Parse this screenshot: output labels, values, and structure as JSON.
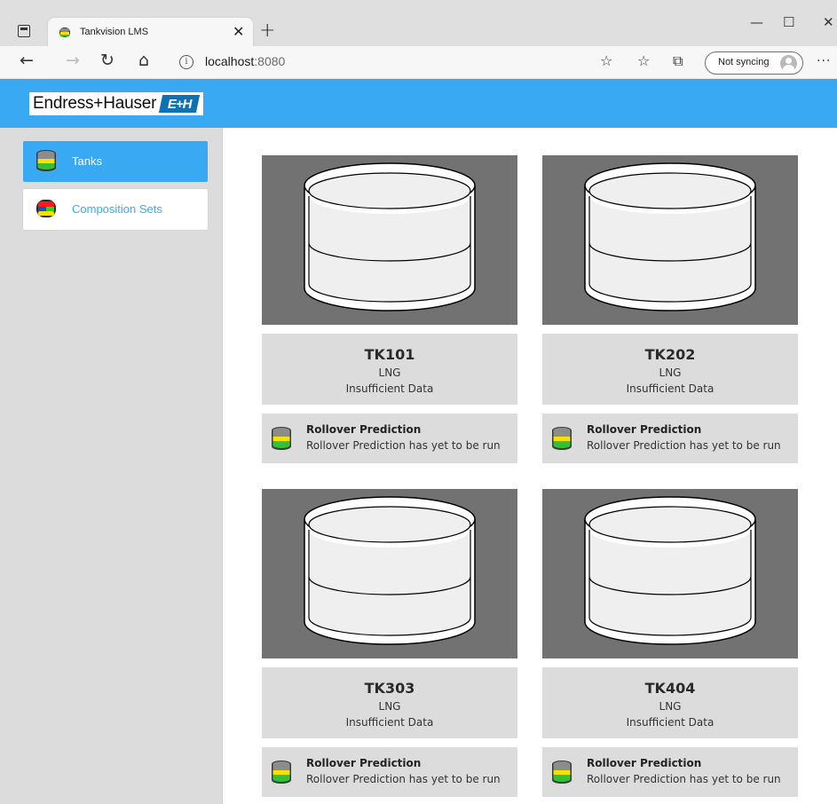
{
  "browser": {
    "tab_title": "Tankvision LMS",
    "url_host": "localhost",
    "url_port": ":8080",
    "sync_label": "Not syncing"
  },
  "app": {
    "brand": "Endress+Hauser",
    "brand_mark": "E+H",
    "accent_color": "#3aa9f4"
  },
  "sidebar": {
    "items": [
      {
        "label": "Tanks",
        "icon": "tank-icon",
        "active": true
      },
      {
        "label": "Composition Sets",
        "icon": "composition-sets-icon",
        "active": false
      }
    ]
  },
  "tanks": [
    {
      "name": "TK101",
      "product": "LNG",
      "status": "Insufficient Data",
      "rollover_title": "Rollover Prediction",
      "rollover_text": "Rollover Prediction has yet to be run"
    },
    {
      "name": "TK202",
      "product": "LNG",
      "status": "Insufficient Data",
      "rollover_title": "Rollover Prediction",
      "rollover_text": "Rollover Prediction has yet to be run"
    },
    {
      "name": "TK303",
      "product": "LNG",
      "status": "Insufficient Data",
      "rollover_title": "Rollover Prediction",
      "rollover_text": "Rollover Prediction has yet to be run"
    },
    {
      "name": "TK404",
      "product": "LNG",
      "status": "Insufficient Data",
      "rollover_title": "Rollover Prediction",
      "rollover_text": "Rollover Prediction has yet to be run"
    }
  ]
}
